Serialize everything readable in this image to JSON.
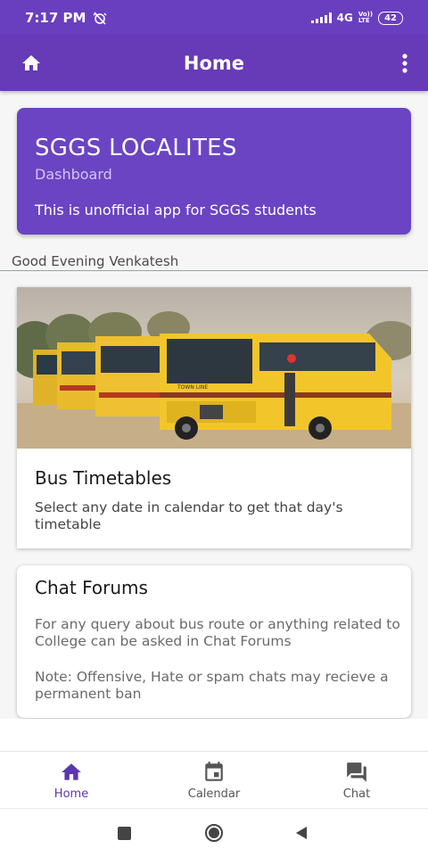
{
  "status_bar": {
    "time": "7:17 PM",
    "network": "4G",
    "carrier_top": "Vo))",
    "carrier_bottom": "LTE",
    "battery": "42"
  },
  "app_bar": {
    "title": "Home",
    "left_icon": "home-icon",
    "right_icon": "more-vert-icon"
  },
  "dashboard": {
    "title": "SGGS LOCALITES",
    "subtitle": "Dashboard",
    "description": "This is unofficial app for SGGS students",
    "color": "#6a44c2"
  },
  "greeting": "Good Evening Venkatesh",
  "bus_card": {
    "title": "Bus Timetables",
    "description": "Select any date in calendar to get that day's timetable",
    "bus_logo": "TOWN LINE"
  },
  "chat_card": {
    "title": "Chat Forums",
    "description": "For any query about bus route or anything related to College can be asked in Chat Forums",
    "note": "Note: Offensive, Hate or spam chats may recieve a permanent ban"
  },
  "bottom_nav": {
    "items": [
      {
        "label": "Home",
        "icon": "home-icon",
        "active": true
      },
      {
        "label": "Calendar",
        "icon": "calendar-icon",
        "active": false
      },
      {
        "label": "Chat",
        "icon": "chat-icon",
        "active": false
      }
    ],
    "active_color": "#5e35b1"
  },
  "colors": {
    "primary": "#673ab7",
    "status_bar": "#6a3fbf"
  }
}
